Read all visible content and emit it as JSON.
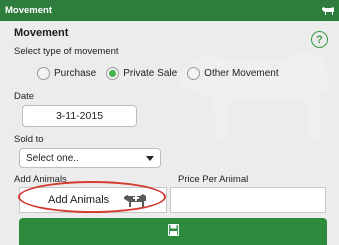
{
  "titlebar": {
    "title": "Movement",
    "icon": "cow-icon"
  },
  "form": {
    "heading": "Movement",
    "help_icon_text": "?",
    "movement_type_label": "Select type of movement",
    "movement_options": [
      {
        "label": "Purchase",
        "selected": false
      },
      {
        "label": "Private Sale",
        "selected": true
      },
      {
        "label": "Other Movement",
        "selected": false
      }
    ],
    "date_label": "Date",
    "date_value": "3-11-2015",
    "sold_to_label": "Sold to",
    "sold_to_value": "Select one..",
    "add_animals_label": "Add Animals",
    "price_per_animal_label": "Price Per Animal",
    "price_per_animal_value": "",
    "add_animals_button_label": "Add Animals",
    "save_icon": "save-icon"
  },
  "colors": {
    "titlebar": "#2f7d3c",
    "accent": "#45b14a",
    "highlight": "#d43b32",
    "save_button": "#2e8b3d"
  }
}
